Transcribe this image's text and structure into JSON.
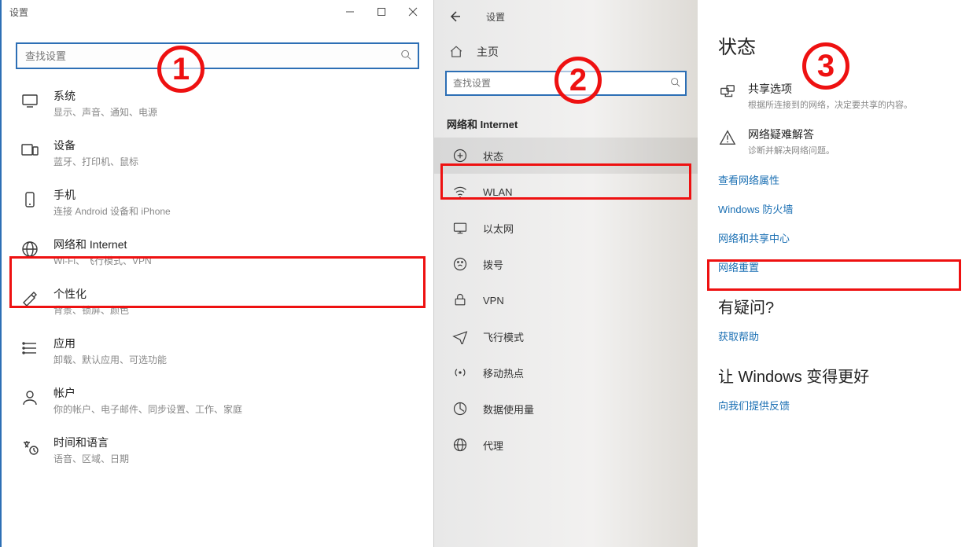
{
  "steps": {
    "s1": "1",
    "s2": "2",
    "s3": "3"
  },
  "panel1": {
    "window_title": "设置",
    "search_placeholder": "查找设置",
    "items": [
      {
        "title": "系统",
        "sub": "显示、声音、通知、电源"
      },
      {
        "title": "设备",
        "sub": "蓝牙、打印机、鼠标"
      },
      {
        "title": "手机",
        "sub": "连接 Android 设备和 iPhone"
      },
      {
        "title": "网络和 Internet",
        "sub": "Wi-Fi、飞行模式、VPN"
      },
      {
        "title": "个性化",
        "sub": "背景、锁屏、颜色"
      },
      {
        "title": "应用",
        "sub": "卸载、默认应用、可选功能"
      },
      {
        "title": "帐户",
        "sub": "你的帐户、电子邮件、同步设置、工作、家庭"
      },
      {
        "title": "时间和语言",
        "sub": "语音、区域、日期"
      }
    ]
  },
  "panel2": {
    "top_title": "设置",
    "home": "主页",
    "search_placeholder": "查找设置",
    "section": "网络和 Internet",
    "items": [
      {
        "label": "状态"
      },
      {
        "label": "WLAN"
      },
      {
        "label": "以太网"
      },
      {
        "label": "拨号"
      },
      {
        "label": "VPN"
      },
      {
        "label": "飞行模式"
      },
      {
        "label": "移动热点"
      },
      {
        "label": "数据使用量"
      },
      {
        "label": "代理"
      }
    ]
  },
  "panel3": {
    "title": "状态",
    "share_title": "共享选项",
    "share_sub": "根据所连接到的网络，决定要共享的内容。",
    "troubleshoot_title": "网络疑难解答",
    "troubleshoot_sub": "诊断并解决网络问题。",
    "link_view_props": "查看网络属性",
    "link_firewall": "Windows 防火墙",
    "link_share_center": "网络和共享中心",
    "link_reset": "网络重置",
    "question_head": "有疑问?",
    "link_help": "获取帮助",
    "better_head": "让 Windows 变得更好",
    "link_feedback": "向我们提供反馈"
  }
}
